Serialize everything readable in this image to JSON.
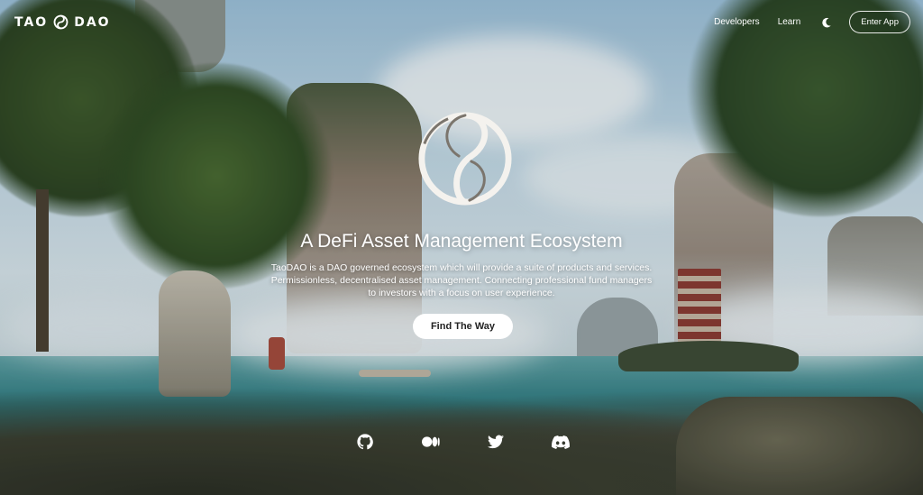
{
  "header": {
    "logo_left": "TAO",
    "logo_right": "DAO",
    "nav": {
      "developers": "Developers",
      "learn": "Learn",
      "theme_icon": "moon-icon",
      "enter_app": "Enter App"
    }
  },
  "hero": {
    "logo_icon": "taodao-yin-yang-icon",
    "title": "A DeFi Asset Management Ecosystem",
    "description": "TaoDAO is a DAO governed ecosystem which will provide a suite of products and services. Permissionless, decentralised asset management. Connecting professional fund managers to investors with a focus on user experience.",
    "cta_label": "Find The Way"
  },
  "social": [
    {
      "icon": "github-icon"
    },
    {
      "icon": "medium-icon"
    },
    {
      "icon": "twitter-icon"
    },
    {
      "icon": "discord-icon"
    }
  ],
  "colors": {
    "text": "#ffffff",
    "button_bg": "#ffffff",
    "button_text": "#222222"
  }
}
